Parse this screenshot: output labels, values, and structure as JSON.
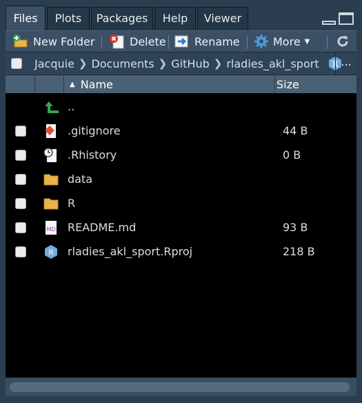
{
  "tabs": [
    "Files",
    "Plots",
    "Packages",
    "Help",
    "Viewer"
  ],
  "toolbar": {
    "new_folder": "New Folder",
    "delete": "Delete",
    "rename": "Rename",
    "more": "More"
  },
  "breadcrumb": [
    "Jacquie",
    "Documents",
    "GitHub",
    "rladies_akl_sport"
  ],
  "breadcrumb_more": "...",
  "columns": {
    "name": "Name",
    "size": "Size"
  },
  "files": [
    {
      "name": "..",
      "size": "",
      "icon": "up-arrow-icon"
    },
    {
      "name": ".gitignore",
      "size": "44 B",
      "icon": "git-file-icon"
    },
    {
      "name": ".Rhistory",
      "size": "0 B",
      "icon": "history-file-icon"
    },
    {
      "name": "data",
      "size": "",
      "icon": "folder-icon"
    },
    {
      "name": "R",
      "size": "",
      "icon": "folder-icon"
    },
    {
      "name": "README.md",
      "size": "93 B",
      "icon": "markdown-file-icon"
    },
    {
      "name": "rladies_akl_sport.Rproj",
      "size": "218 B",
      "icon": "rproj-file-icon"
    }
  ],
  "colors": {
    "pane": "#2b3e50",
    "list_bg": "#000000",
    "folder": "#e8b648",
    "up_arrow": "#2fa84f",
    "git": "#e44c30",
    "md": "#a43bb5",
    "rproj": "#75aadb"
  }
}
